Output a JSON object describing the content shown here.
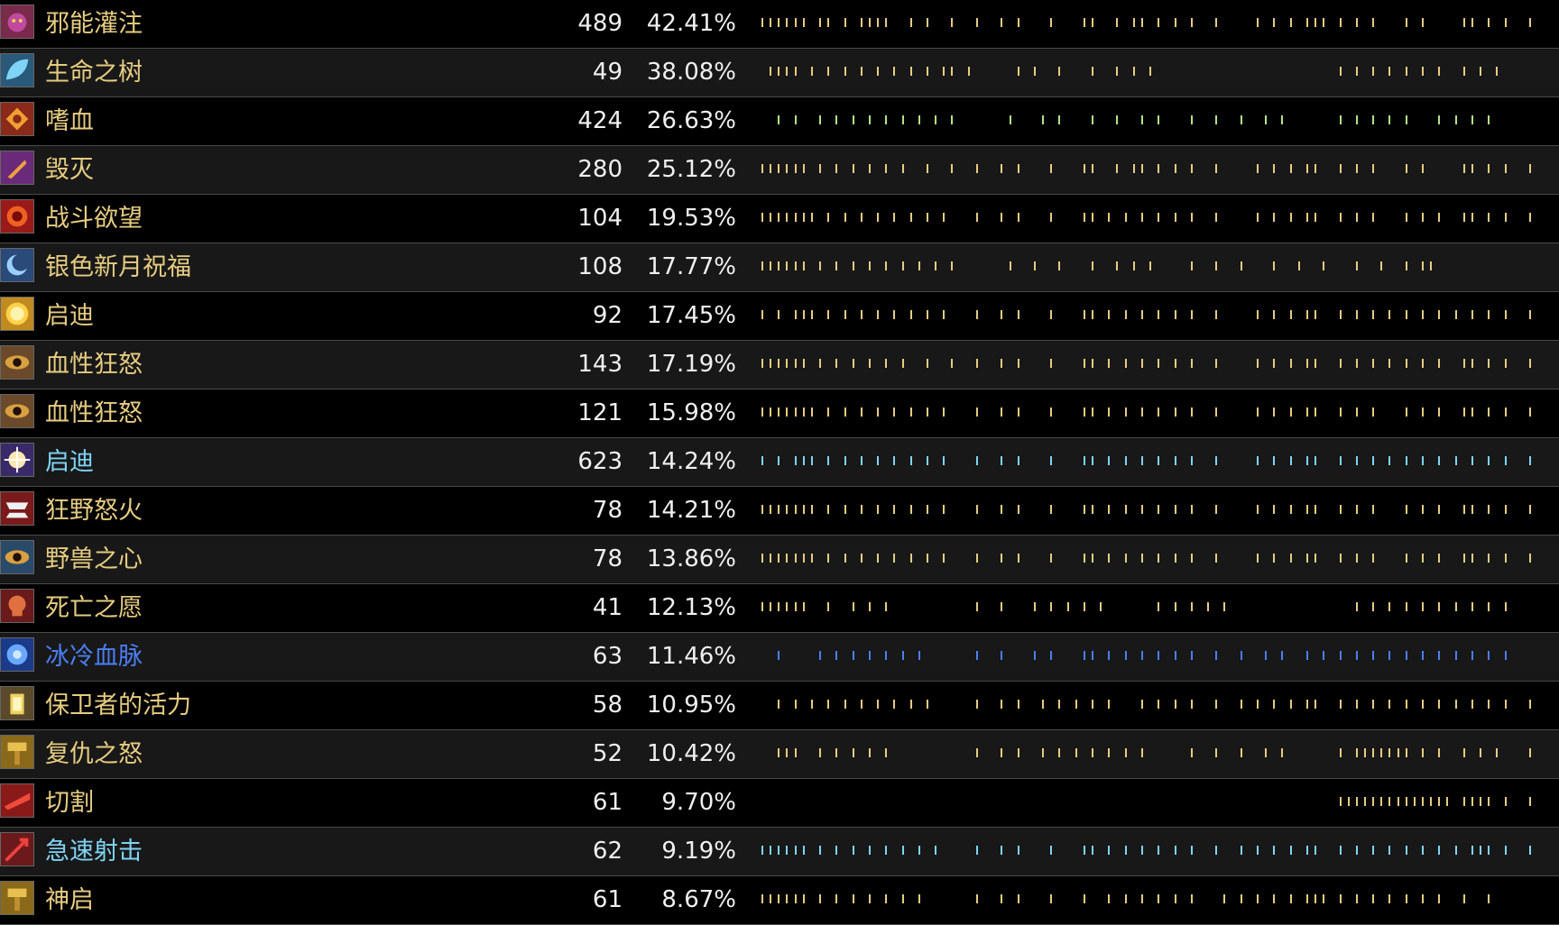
{
  "rows": [
    {
      "name": "邪能灌注",
      "count": "489",
      "pct": "42.41%",
      "color": "#e6cc80",
      "icon": "demon-icon",
      "iconColor": "#7a2a4a",
      "tickColor": "#e6cc80",
      "ticks": [
        0,
        1,
        2,
        3,
        4,
        5,
        7,
        8,
        10,
        12,
        13,
        14,
        15,
        18,
        20,
        23,
        26,
        29,
        31,
        35,
        39,
        40,
        43,
        45,
        46,
        48,
        50,
        52,
        55,
        60,
        62,
        64,
        66,
        67,
        68,
        70,
        72,
        74,
        78,
        80,
        85,
        86,
        88,
        90,
        93
      ]
    },
    {
      "name": "生命之树",
      "count": "49",
      "pct": "38.08%",
      "color": "#e6cc80",
      "icon": "leaf-icon",
      "iconColor": "#2a5a7a",
      "tickColor": "#e6cc80",
      "ticks": [
        1,
        2,
        3,
        4,
        6,
        8,
        10,
        12,
        14,
        16,
        18,
        20,
        22,
        23,
        25,
        31,
        33,
        36,
        40,
        43,
        45,
        47,
        70,
        72,
        74,
        76,
        78,
        80,
        82,
        85,
        87,
        89
      ]
    },
    {
      "name": "嗜血",
      "count": "424",
      "pct": "26.63%",
      "color": "#e6cc80",
      "icon": "fist-icon",
      "iconColor": "#8a2a1a",
      "tickColor": "#b5e08a",
      "ticks": [
        2,
        4,
        7,
        9,
        11,
        13,
        15,
        17,
        19,
        21,
        23,
        30,
        34,
        36,
        40,
        43,
        46,
        48,
        52,
        55,
        58,
        61,
        63,
        70,
        72,
        74,
        76,
        78,
        82,
        84,
        86,
        88
      ]
    },
    {
      "name": "毁灭",
      "count": "280",
      "pct": "25.12%",
      "color": "#e6cc80",
      "icon": "dagger-icon",
      "iconColor": "#6a2a7a",
      "tickColor": "#e6cc80",
      "ticks": [
        0,
        1,
        2,
        3,
        4,
        5,
        7,
        9,
        11,
        13,
        15,
        17,
        20,
        23,
        26,
        29,
        31,
        35,
        39,
        40,
        43,
        45,
        46,
        48,
        50,
        52,
        55,
        60,
        62,
        64,
        66,
        67,
        70,
        72,
        74,
        78,
        80,
        85,
        86,
        88,
        90,
        93
      ]
    },
    {
      "name": "战斗欲望",
      "count": "104",
      "pct": "19.53%",
      "color": "#e6cc80",
      "icon": "rage-icon",
      "iconColor": "#9a1a1a",
      "tickColor": "#e6cc80",
      "ticks": [
        0,
        1,
        2,
        3,
        4,
        5,
        6,
        8,
        10,
        12,
        14,
        16,
        18,
        20,
        22,
        26,
        29,
        31,
        35,
        39,
        40,
        42,
        44,
        46,
        48,
        50,
        52,
        55,
        60,
        62,
        64,
        66,
        67,
        70,
        72,
        74,
        78,
        80,
        82,
        85,
        86,
        88,
        90,
        93
      ]
    },
    {
      "name": "银色新月祝福",
      "count": "108",
      "pct": "17.77%",
      "color": "#e6cc80",
      "icon": "crescent-icon",
      "iconColor": "#2a4a7a",
      "tickColor": "#e6cc80",
      "ticks": [
        0,
        1,
        2,
        3,
        4,
        5,
        7,
        9,
        11,
        13,
        15,
        17,
        19,
        21,
        23,
        30,
        33,
        36,
        40,
        43,
        45,
        47,
        52,
        55,
        58,
        62,
        65,
        68,
        72,
        75,
        78,
        80,
        81
      ]
    },
    {
      "name": "启迪",
      "count": "92",
      "pct": "17.45%",
      "color": "#e6cc80",
      "icon": "sun-icon",
      "iconColor": "#c08a20",
      "tickColor": "#e6cc80",
      "ticks": [
        0,
        2,
        4,
        5,
        6,
        8,
        10,
        12,
        14,
        16,
        18,
        20,
        22,
        26,
        29,
        31,
        35,
        39,
        40,
        42,
        44,
        46,
        48,
        50,
        52,
        55,
        60,
        62,
        64,
        66,
        67,
        70,
        72,
        74,
        76,
        78,
        80,
        82,
        84,
        86,
        88,
        90,
        93
      ]
    },
    {
      "name": "血性狂怒",
      "count": "143",
      "pct": "17.19%",
      "color": "#e6cc80",
      "icon": "eye-icon",
      "iconColor": "#6a4a2a",
      "tickColor": "#e6cc80",
      "ticks": [
        0,
        1,
        2,
        3,
        4,
        5,
        7,
        9,
        11,
        13,
        15,
        17,
        20,
        23,
        26,
        29,
        31,
        35,
        39,
        40,
        42,
        44,
        46,
        48,
        50,
        52,
        55,
        60,
        62,
        64,
        66,
        67,
        70,
        72,
        74,
        76,
        78,
        80,
        82,
        85,
        86,
        88,
        90,
        93
      ]
    },
    {
      "name": "血性狂怒",
      "count": "121",
      "pct": "15.98%",
      "color": "#e6cc80",
      "icon": "eye-icon",
      "iconColor": "#6a4a2a",
      "tickColor": "#e6cc80",
      "ticks": [
        0,
        1,
        2,
        3,
        4,
        5,
        6,
        8,
        10,
        12,
        14,
        16,
        18,
        20,
        22,
        26,
        29,
        31,
        35,
        39,
        40,
        42,
        44,
        46,
        48,
        50,
        52,
        55,
        60,
        62,
        64,
        66,
        67,
        70,
        72,
        74,
        78,
        80,
        82,
        85,
        86,
        88,
        90,
        93
      ]
    },
    {
      "name": "启迪",
      "count": "623",
      "pct": "14.24%",
      "color": "#7fd4f5",
      "icon": "spark-icon",
      "iconColor": "#3a2a6a",
      "tickColor": "#7fd4f5",
      "ticks": [
        0,
        2,
        4,
        5,
        6,
        8,
        10,
        12,
        14,
        16,
        18,
        20,
        22,
        26,
        29,
        31,
        35,
        39,
        40,
        42,
        44,
        46,
        48,
        50,
        52,
        55,
        60,
        62,
        64,
        66,
        67,
        70,
        72,
        74,
        76,
        78,
        80,
        82,
        84,
        86,
        88,
        90,
        93
      ]
    },
    {
      "name": "狂野怒火",
      "count": "78",
      "pct": "14.21%",
      "color": "#e6cc80",
      "icon": "jaws-icon",
      "iconColor": "#7a1a1a",
      "tickColor": "#e6cc80",
      "ticks": [
        0,
        1,
        2,
        3,
        4,
        5,
        6,
        8,
        10,
        12,
        14,
        16,
        18,
        20,
        22,
        26,
        29,
        31,
        35,
        39,
        40,
        42,
        44,
        46,
        48,
        50,
        52,
        55,
        60,
        62,
        64,
        66,
        67,
        70,
        72,
        74,
        78,
        80,
        82,
        85,
        86,
        88,
        90,
        93
      ]
    },
    {
      "name": "野兽之心",
      "count": "78",
      "pct": "13.86%",
      "color": "#e6cc80",
      "icon": "beast-eye-icon",
      "iconColor": "#2a4a6a",
      "tickColor": "#e6cc80",
      "ticks": [
        0,
        1,
        2,
        3,
        4,
        5,
        6,
        8,
        10,
        12,
        14,
        16,
        18,
        20,
        22,
        26,
        29,
        31,
        35,
        39,
        40,
        42,
        44,
        46,
        48,
        50,
        52,
        55,
        60,
        62,
        64,
        66,
        67,
        70,
        72,
        74,
        78,
        80,
        82,
        85,
        86,
        88,
        90,
        93
      ]
    },
    {
      "name": "死亡之愿",
      "count": "41",
      "pct": "12.13%",
      "color": "#e6cc80",
      "icon": "skull-icon",
      "iconColor": "#6a1a1a",
      "tickColor": "#e6cc80",
      "ticks": [
        0,
        1,
        2,
        3,
        4,
        5,
        8,
        11,
        13,
        15,
        26,
        29,
        33,
        35,
        37,
        39,
        41,
        48,
        50,
        52,
        54,
        56,
        72,
        74,
        76,
        78,
        80,
        82,
        84,
        86,
        88,
        90
      ]
    },
    {
      "name": "冰冷血脉",
      "count": "63",
      "pct": "11.46%",
      "color": "#4a7ff5",
      "icon": "frost-icon",
      "iconColor": "#1a3a8a",
      "tickColor": "#4a7ff5",
      "ticks": [
        2,
        7,
        9,
        11,
        13,
        15,
        17,
        19,
        26,
        29,
        33,
        35,
        39,
        40,
        42,
        44,
        46,
        48,
        50,
        52,
        55,
        58,
        61,
        63,
        66,
        68,
        70,
        72,
        74,
        76,
        78,
        80,
        82,
        84,
        86,
        88,
        90
      ]
    },
    {
      "name": "保卫者的活力",
      "count": "58",
      "pct": "10.95%",
      "color": "#e6cc80",
      "icon": "lantern-icon",
      "iconColor": "#5a4a2a",
      "tickColor": "#e6cc80",
      "ticks": [
        2,
        4,
        6,
        8,
        10,
        12,
        14,
        16,
        18,
        20,
        26,
        29,
        31,
        34,
        36,
        38,
        40,
        42,
        46,
        48,
        50,
        52,
        55,
        58,
        60,
        62,
        64,
        66,
        67,
        70,
        72,
        74,
        76,
        78,
        80,
        82,
        84,
        86,
        88,
        90,
        93
      ]
    },
    {
      "name": "复仇之怒",
      "count": "52",
      "pct": "10.42%",
      "color": "#e6cc80",
      "icon": "hammer-icon",
      "iconColor": "#8a6a1a",
      "tickColor": "#e6cc80",
      "ticks": [
        2,
        3,
        4,
        7,
        9,
        11,
        13,
        15,
        26,
        29,
        31,
        34,
        36,
        38,
        40,
        42,
        44,
        46,
        52,
        55,
        58,
        61,
        63,
        70,
        72,
        73,
        74,
        75,
        76,
        77,
        78,
        80,
        82,
        85,
        87,
        89,
        93
      ]
    },
    {
      "name": "切割",
      "count": "61",
      "pct": "9.70%",
      "color": "#e6cc80",
      "icon": "slice-icon",
      "iconColor": "#8a1a1a",
      "tickColor": "#e6cc80",
      "ticks": [
        70,
        71,
        72,
        73,
        74,
        75,
        76,
        77,
        78,
        79,
        80,
        81,
        82,
        83,
        85,
        86,
        87,
        88,
        90,
        93
      ]
    },
    {
      "name": "急速射击",
      "count": "62",
      "pct": "9.19%",
      "color": "#7fd4f5",
      "icon": "arrow-icon",
      "iconColor": "#6a1a1a",
      "tickColor": "#7fd4f5",
      "ticks": [
        0,
        1,
        2,
        3,
        4,
        5,
        7,
        9,
        11,
        13,
        15,
        17,
        19,
        21,
        26,
        29,
        31,
        35,
        39,
        40,
        42,
        44,
        46,
        48,
        50,
        52,
        55,
        58,
        60,
        62,
        64,
        66,
        67,
        70,
        72,
        74,
        76,
        78,
        80,
        82,
        84,
        86,
        87,
        88,
        90,
        93
      ]
    },
    {
      "name": "神启",
      "count": "61",
      "pct": "8.67%",
      "color": "#e6cc80",
      "icon": "hammer-icon",
      "iconColor": "#8a6a1a",
      "tickColor": "#e6cc80",
      "ticks": [
        0,
        1,
        2,
        3,
        4,
        5,
        7,
        9,
        11,
        13,
        15,
        17,
        19,
        26,
        29,
        31,
        35,
        39,
        42,
        44,
        46,
        48,
        50,
        52,
        56,
        58,
        60,
        62,
        64,
        66,
        67,
        68,
        70,
        72,
        74,
        76,
        78,
        80,
        82,
        85,
        88
      ]
    }
  ]
}
